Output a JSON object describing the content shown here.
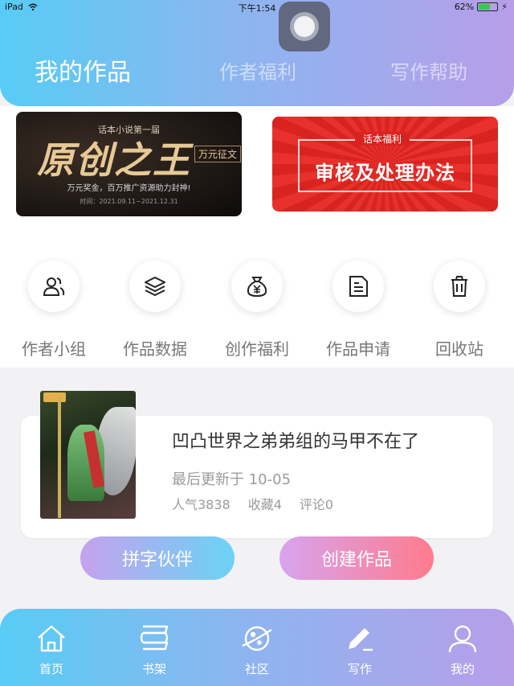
{
  "status_bar": {
    "device": "iPad",
    "time": "下午1:54",
    "battery_text": "62%",
    "battery_level": 0.62
  },
  "tabs": [
    {
      "label": "我的作品",
      "active": true
    },
    {
      "label": "作者福利",
      "active": false
    },
    {
      "label": "写作帮助",
      "active": false
    }
  ],
  "banners": {
    "contest": {
      "small": "话本小说第一届",
      "big": "原创之王",
      "tag": "万元征文",
      "sub": "万元奖金，百万推广资源助力封神!",
      "date": "时间：2021.09.11~2021.12.31"
    },
    "notice": {
      "cap": "话本福利",
      "title": "审核及处理办法"
    }
  },
  "quick_actions": [
    {
      "label": "作者小组",
      "icon": "people-icon"
    },
    {
      "label": "作品数据",
      "icon": "layers-icon"
    },
    {
      "label": "创作福利",
      "icon": "money-bag-icon"
    },
    {
      "label": "作品申请",
      "icon": "document-icon"
    },
    {
      "label": "回收站",
      "icon": "trash-icon"
    }
  ],
  "work": {
    "title": "凹凸世界之弟弟组的马甲不在了",
    "updated": "最后更新于 10-05",
    "popularity": "人气3838",
    "favorites": "收藏4",
    "comments": "评论0"
  },
  "actions": {
    "partner": "拼字伙伴",
    "create": "创建作品"
  },
  "bottom_nav": [
    {
      "label": "首页",
      "icon": "home-icon"
    },
    {
      "label": "书架",
      "icon": "bookshelf-icon"
    },
    {
      "label": "社区",
      "icon": "planet-icon"
    },
    {
      "label": "写作",
      "icon": "pen-icon",
      "active": true
    },
    {
      "label": "我的",
      "icon": "user-icon"
    }
  ],
  "colors": {
    "gradient_start": "#57ccf4",
    "gradient_end": "#b79ee9",
    "create_pink": "#ff7b8e"
  }
}
